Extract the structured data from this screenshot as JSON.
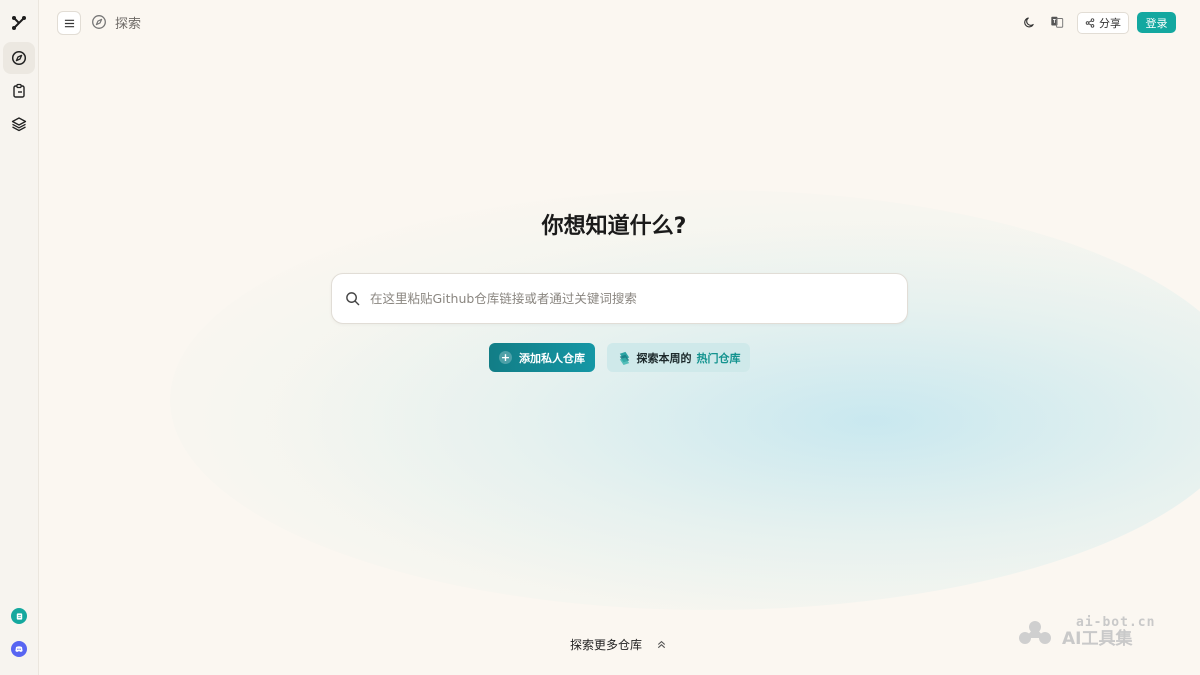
{
  "sidebar": {
    "icons": [
      "logo-icon",
      "compass-icon",
      "clipboard-icon",
      "layers-icon",
      "docs-icon",
      "discord-icon"
    ],
    "colors": {
      "docs": "#15a89e",
      "discord": "#5865f2"
    }
  },
  "header": {
    "breadcrumb": "探索",
    "share_label": "分享",
    "login_label": "登录"
  },
  "main": {
    "title": "你想知道什么?",
    "search": {
      "placeholder": "在这里粘贴Github仓库链接或者通过关键词搜索",
      "value": ""
    },
    "add_private_label": "添加私人仓库",
    "explore_label": "探索本周的",
    "hot_label": "热门仓库",
    "more_label": "探索更多仓库"
  },
  "watermark": {
    "url": "ai-bot.cn",
    "name": "AI工具集"
  },
  "colors": {
    "accent": "#13a8a0",
    "background": "#fbf7f1"
  }
}
